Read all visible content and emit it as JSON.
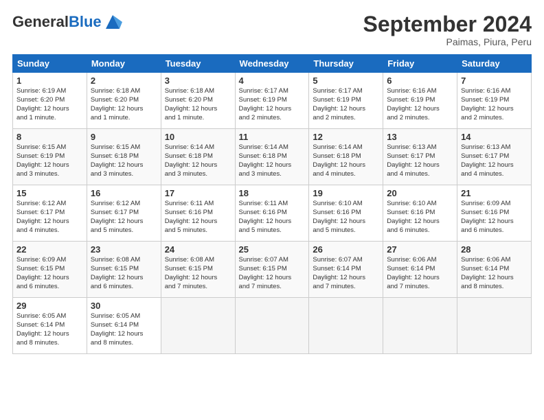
{
  "header": {
    "logo_line1": "General",
    "logo_line2": "Blue",
    "month_title": "September 2024",
    "location": "Paimas, Piura, Peru"
  },
  "days_of_week": [
    "Sunday",
    "Monday",
    "Tuesday",
    "Wednesday",
    "Thursday",
    "Friday",
    "Saturday"
  ],
  "weeks": [
    [
      {
        "num": "1",
        "sunrise": "Sunrise: 6:19 AM",
        "sunset": "Sunset: 6:20 PM",
        "daylight": "Daylight: 12 hours and 1 minute."
      },
      {
        "num": "2",
        "sunrise": "Sunrise: 6:18 AM",
        "sunset": "Sunset: 6:20 PM",
        "daylight": "Daylight: 12 hours and 1 minute."
      },
      {
        "num": "3",
        "sunrise": "Sunrise: 6:18 AM",
        "sunset": "Sunset: 6:20 PM",
        "daylight": "Daylight: 12 hours and 1 minute."
      },
      {
        "num": "4",
        "sunrise": "Sunrise: 6:17 AM",
        "sunset": "Sunset: 6:19 PM",
        "daylight": "Daylight: 12 hours and 2 minutes."
      },
      {
        "num": "5",
        "sunrise": "Sunrise: 6:17 AM",
        "sunset": "Sunset: 6:19 PM",
        "daylight": "Daylight: 12 hours and 2 minutes."
      },
      {
        "num": "6",
        "sunrise": "Sunrise: 6:16 AM",
        "sunset": "Sunset: 6:19 PM",
        "daylight": "Daylight: 12 hours and 2 minutes."
      },
      {
        "num": "7",
        "sunrise": "Sunrise: 6:16 AM",
        "sunset": "Sunset: 6:19 PM",
        "daylight": "Daylight: 12 hours and 2 minutes."
      }
    ],
    [
      {
        "num": "8",
        "sunrise": "Sunrise: 6:15 AM",
        "sunset": "Sunset: 6:19 PM",
        "daylight": "Daylight: 12 hours and 3 minutes."
      },
      {
        "num": "9",
        "sunrise": "Sunrise: 6:15 AM",
        "sunset": "Sunset: 6:18 PM",
        "daylight": "Daylight: 12 hours and 3 minutes."
      },
      {
        "num": "10",
        "sunrise": "Sunrise: 6:14 AM",
        "sunset": "Sunset: 6:18 PM",
        "daylight": "Daylight: 12 hours and 3 minutes."
      },
      {
        "num": "11",
        "sunrise": "Sunrise: 6:14 AM",
        "sunset": "Sunset: 6:18 PM",
        "daylight": "Daylight: 12 hours and 3 minutes."
      },
      {
        "num": "12",
        "sunrise": "Sunrise: 6:14 AM",
        "sunset": "Sunset: 6:18 PM",
        "daylight": "Daylight: 12 hours and 4 minutes."
      },
      {
        "num": "13",
        "sunrise": "Sunrise: 6:13 AM",
        "sunset": "Sunset: 6:17 PM",
        "daylight": "Daylight: 12 hours and 4 minutes."
      },
      {
        "num": "14",
        "sunrise": "Sunrise: 6:13 AM",
        "sunset": "Sunset: 6:17 PM",
        "daylight": "Daylight: 12 hours and 4 minutes."
      }
    ],
    [
      {
        "num": "15",
        "sunrise": "Sunrise: 6:12 AM",
        "sunset": "Sunset: 6:17 PM",
        "daylight": "Daylight: 12 hours and 4 minutes."
      },
      {
        "num": "16",
        "sunrise": "Sunrise: 6:12 AM",
        "sunset": "Sunset: 6:17 PM",
        "daylight": "Daylight: 12 hours and 5 minutes."
      },
      {
        "num": "17",
        "sunrise": "Sunrise: 6:11 AM",
        "sunset": "Sunset: 6:16 PM",
        "daylight": "Daylight: 12 hours and 5 minutes."
      },
      {
        "num": "18",
        "sunrise": "Sunrise: 6:11 AM",
        "sunset": "Sunset: 6:16 PM",
        "daylight": "Daylight: 12 hours and 5 minutes."
      },
      {
        "num": "19",
        "sunrise": "Sunrise: 6:10 AM",
        "sunset": "Sunset: 6:16 PM",
        "daylight": "Daylight: 12 hours and 5 minutes."
      },
      {
        "num": "20",
        "sunrise": "Sunrise: 6:10 AM",
        "sunset": "Sunset: 6:16 PM",
        "daylight": "Daylight: 12 hours and 6 minutes."
      },
      {
        "num": "21",
        "sunrise": "Sunrise: 6:09 AM",
        "sunset": "Sunset: 6:16 PM",
        "daylight": "Daylight: 12 hours and 6 minutes."
      }
    ],
    [
      {
        "num": "22",
        "sunrise": "Sunrise: 6:09 AM",
        "sunset": "Sunset: 6:15 PM",
        "daylight": "Daylight: 12 hours and 6 minutes."
      },
      {
        "num": "23",
        "sunrise": "Sunrise: 6:08 AM",
        "sunset": "Sunset: 6:15 PM",
        "daylight": "Daylight: 12 hours and 6 minutes."
      },
      {
        "num": "24",
        "sunrise": "Sunrise: 6:08 AM",
        "sunset": "Sunset: 6:15 PM",
        "daylight": "Daylight: 12 hours and 7 minutes."
      },
      {
        "num": "25",
        "sunrise": "Sunrise: 6:07 AM",
        "sunset": "Sunset: 6:15 PM",
        "daylight": "Daylight: 12 hours and 7 minutes."
      },
      {
        "num": "26",
        "sunrise": "Sunrise: 6:07 AM",
        "sunset": "Sunset: 6:14 PM",
        "daylight": "Daylight: 12 hours and 7 minutes."
      },
      {
        "num": "27",
        "sunrise": "Sunrise: 6:06 AM",
        "sunset": "Sunset: 6:14 PM",
        "daylight": "Daylight: 12 hours and 7 minutes."
      },
      {
        "num": "28",
        "sunrise": "Sunrise: 6:06 AM",
        "sunset": "Sunset: 6:14 PM",
        "daylight": "Daylight: 12 hours and 8 minutes."
      }
    ],
    [
      {
        "num": "29",
        "sunrise": "Sunrise: 6:05 AM",
        "sunset": "Sunset: 6:14 PM",
        "daylight": "Daylight: 12 hours and 8 minutes."
      },
      {
        "num": "30",
        "sunrise": "Sunrise: 6:05 AM",
        "sunset": "Sunset: 6:14 PM",
        "daylight": "Daylight: 12 hours and 8 minutes."
      },
      null,
      null,
      null,
      null,
      null
    ]
  ]
}
